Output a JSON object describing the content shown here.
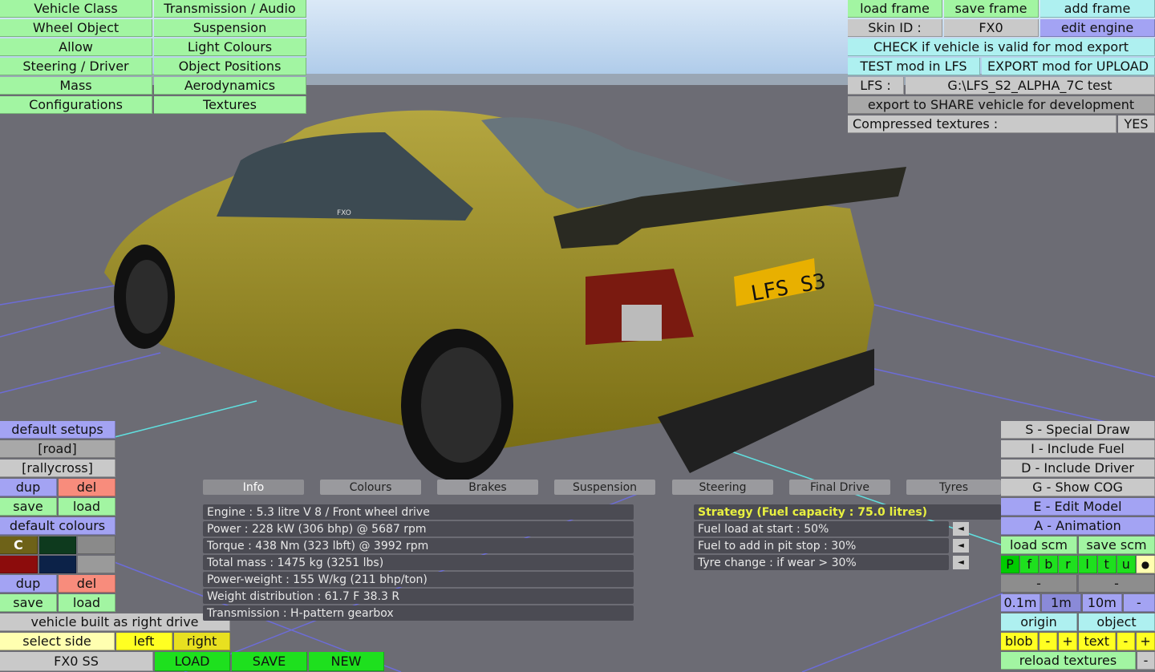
{
  "top_menu": [
    "Vehicle Class",
    "Transmission / Audio",
    "Wheel Object",
    "Suspension",
    "Allow",
    "Light Colours",
    "Steering / Driver",
    "Object Positions",
    "Mass",
    "Aerodynamics",
    "Configurations",
    "Textures"
  ],
  "top_right": {
    "load_frame": "load frame",
    "save_frame": "save frame",
    "add_frame": "add frame",
    "skin_label": "Skin ID :",
    "skin_value": "FX0",
    "edit_engine": "edit engine",
    "check": "CHECK if vehicle is valid for mod export",
    "test": "TEST mod in LFS",
    "export": "EXPORT mod for UPLOAD",
    "lfs_label": "LFS :",
    "lfs_path": "G:\\LFS_S2_ALPHA_7C test",
    "share": "export to SHARE vehicle for development",
    "compressed_label": "Compressed textures :",
    "compressed_value": "YES"
  },
  "left_panel": {
    "default_setups": "default setups",
    "road": "[road]",
    "rallycross": "[rallycross]",
    "dup": "dup",
    "del": "del",
    "save": "save",
    "load": "load",
    "default_colours": "default colours",
    "colour_c": "C",
    "colours": [
      "#6e6218",
      "#0e3a1e",
      "#8a8a8a",
      "#8c0c0c",
      "#0c2248",
      "#9a9a9a"
    ],
    "right_drive": "vehicle built as right drive",
    "select_side": "select side",
    "left": "left",
    "right": "right",
    "car_name": "FX0 SS",
    "load_btn": "LOAD",
    "save_btn": "SAVE",
    "new_btn": "NEW"
  },
  "right_panel": {
    "special": "S - Special Draw",
    "fuel": "I - Include Fuel",
    "driver": "D - Include Driver",
    "cog": "G - Show COG",
    "edit_model": "E - Edit Model",
    "animation": "A - Animation",
    "load_scm": "load scm",
    "save_scm": "save scm",
    "views": [
      "P",
      "f",
      "b",
      "r",
      "l",
      "t",
      "u",
      "●"
    ],
    "dash1": "-",
    "dash2": "-",
    "grid": [
      "0.1m",
      "1m",
      "10m",
      "-"
    ],
    "origin": "origin",
    "object": "object",
    "blob": "blob",
    "minus": "-",
    "plus": "+",
    "text": "text",
    "reload": "reload textures",
    "reload_dash": "-"
  },
  "tabs": [
    "Info",
    "Colours",
    "Brakes",
    "Suspension",
    "Steering",
    "Final Drive",
    "Tyres"
  ],
  "info": [
    "Engine : 5.3 litre V 8 / Front wheel drive",
    "Power : 228 kW (306 bhp) @ 5687 rpm",
    "Torque : 438 Nm (323 lbft) @ 3992 rpm",
    "Total mass : 1475 kg (3251 lbs)",
    "Power-weight : 155 W/kg (211 bhp/ton)",
    "Weight distribution : 61.7 F  38.3 R",
    "Transmission : H-pattern gearbox"
  ],
  "strategy": {
    "title": "Strategy (Fuel capacity : 75.0 litres)",
    "rows": [
      "Fuel load at start : 50%",
      "Fuel to add in pit stop : 30%",
      "Tyre change : if wear > 30%"
    ],
    "arrow": "◄"
  },
  "car": {
    "plate": "LFS S3",
    "badge": "FXO"
  }
}
